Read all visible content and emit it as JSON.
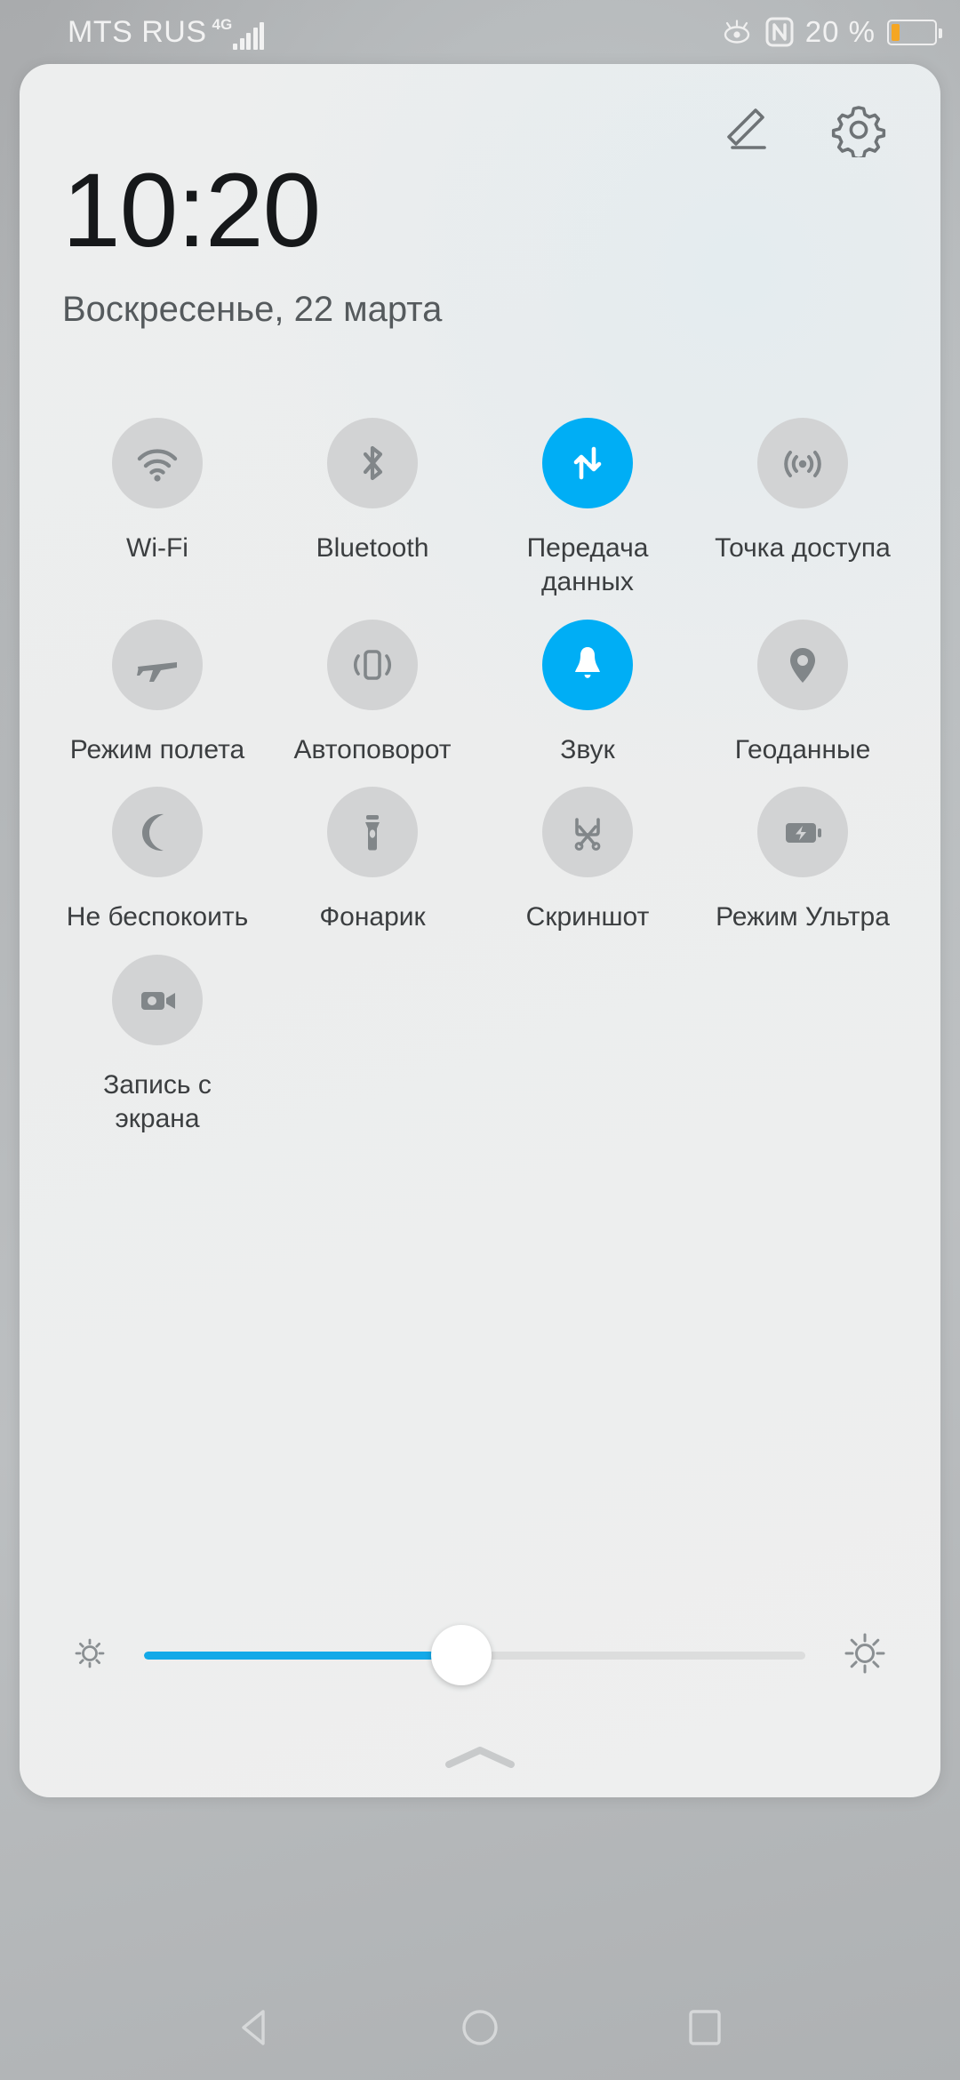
{
  "status_bar": {
    "carrier": "MTS RUS",
    "network_type": "4G",
    "signal_bars": 5,
    "eye_comfort_icon": "eye-icon",
    "nfc_icon": "nfc-icon",
    "battery_percent_label": "20 %",
    "battery_level": 20,
    "battery_color": "#f5a623"
  },
  "panel": {
    "edit_icon": "pencil-icon",
    "settings_icon": "gear-icon",
    "clock": "10:20",
    "date": "Воскресенье, 22 марта",
    "accent_color": "#00aef5",
    "inactive_tile_color": "#d2d3d4"
  },
  "tiles": [
    {
      "label": "Wi-Fi",
      "icon": "wifi-icon",
      "active": false
    },
    {
      "label": "Bluetooth",
      "icon": "bluetooth-icon",
      "active": false
    },
    {
      "label": "Передача данных",
      "icon": "mobile-data-icon",
      "active": true
    },
    {
      "label": "Точка доступа",
      "icon": "hotspot-icon",
      "active": false
    },
    {
      "label": "Режим полета",
      "icon": "airplane-icon",
      "active": false
    },
    {
      "label": "Автоповорот",
      "icon": "auto-rotate-icon",
      "active": false
    },
    {
      "label": "Звук",
      "icon": "bell-icon",
      "active": true
    },
    {
      "label": "Геоданные",
      "icon": "location-pin-icon",
      "active": false
    },
    {
      "label": "Не беспокоить",
      "icon": "moon-icon",
      "active": false
    },
    {
      "label": "Фонарик",
      "icon": "flashlight-icon",
      "active": false
    },
    {
      "label": "Скриншот",
      "icon": "scissors-icon",
      "active": false
    },
    {
      "label": "Режим Ультра",
      "icon": "battery-bolt-icon",
      "active": false
    },
    {
      "label": "Запись с экрана",
      "icon": "video-camera-icon",
      "active": false
    }
  ],
  "brightness": {
    "value_percent": 48,
    "low_icon": "brightness-low-icon",
    "high_icon": "brightness-high-icon",
    "fill_color": "#13a9e8"
  },
  "collapse_handle_icon": "chevron-up-icon",
  "nav_bar": {
    "back_icon": "back-triangle-icon",
    "home_icon": "home-circle-icon",
    "recents_icon": "recents-square-icon"
  }
}
